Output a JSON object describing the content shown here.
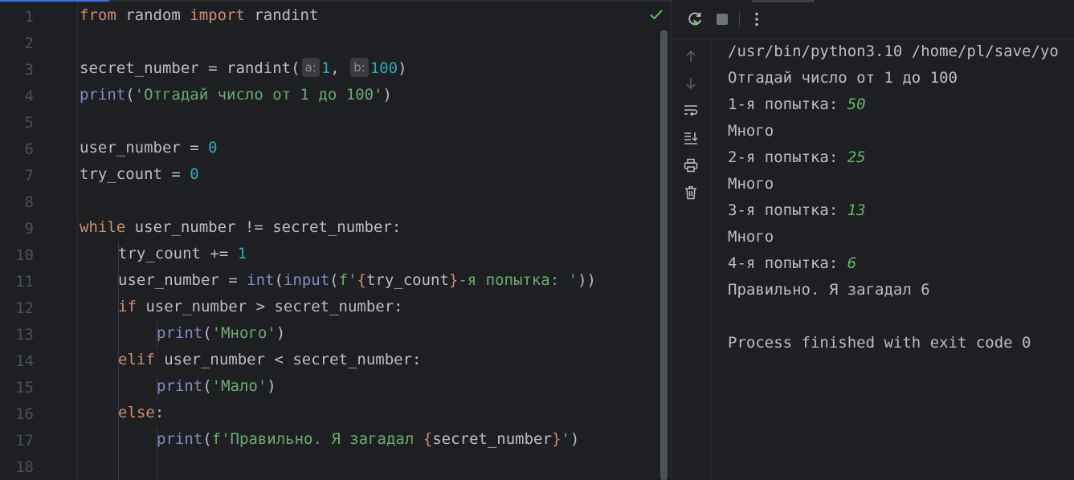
{
  "editor": {
    "line_numbers": [
      "1",
      "2",
      "3",
      "4",
      "5",
      "6",
      "7",
      "8",
      "9",
      "10",
      "11",
      "12",
      "13",
      "14",
      "15",
      "16",
      "17",
      "18"
    ],
    "hints": {
      "a": "a:",
      "b": "b:"
    },
    "tokens": {
      "l1_from": "from",
      "l1_mod": " random ",
      "l1_import": "import",
      "l1_name": " randint",
      "l3_var": "secret_number = ",
      "l3_fn": "randint",
      "l3_open": "(",
      "l3_a": "1",
      "l3_comma": ", ",
      "l3_b": "100",
      "l3_close": ")",
      "l4_print": "print",
      "l4_open": "(",
      "l4_str": "'Отгадай число от 1 до 100'",
      "l4_close": ")",
      "l6_var": "user_number = ",
      "l6_val": "0",
      "l7_var": "try_count = ",
      "l7_val": "0",
      "l9_while": "while",
      "l9_rest": " user_number != secret_number:",
      "l10_var": "try_count += ",
      "l10_val": "1",
      "l11_var": "user_number = ",
      "l11_int": "int",
      "l11_p1": "(",
      "l11_input": "input",
      "l11_p2": "(",
      "l11_fpre": "f'",
      "l11_brace1": "{",
      "l11_expr": "try_count",
      "l11_brace2": "}",
      "l11_str": "-я попытка: '",
      "l11_close": "))",
      "l12_if": "if",
      "l12_rest": " user_number > secret_number:",
      "l13_print": "print",
      "l13_open": "(",
      "l13_str": "'Много'",
      "l13_close": ")",
      "l14_elif": "elif",
      "l14_rest": " user_number < secret_number:",
      "l15_print": "print",
      "l15_open": "(",
      "l15_str": "'Мало'",
      "l15_close": ")",
      "l16_else": "else",
      "l16_colon": ":",
      "l17_print": "print",
      "l17_open": "(",
      "l17_fpre": "f'Правильно. Я загадал ",
      "l17_brace1": "{",
      "l17_expr": "secret_number",
      "l17_brace2": "}",
      "l17_str": "'",
      "l17_close": ")"
    }
  },
  "run": {
    "icons": [
      "rerun-icon",
      "stop-icon",
      "more-options-icon",
      "arrow-up-icon",
      "arrow-down-icon",
      "soft-wrap-icon",
      "scroll-to-end-icon",
      "print-icon",
      "trash-icon"
    ],
    "console": {
      "l1": "/usr/bin/python3.10 /home/pl/save/yo",
      "l2": "Отгадай число от 1 до 100",
      "l3_prompt": "1-я попытка: ",
      "l3_in": "50",
      "l4": "Много",
      "l5_prompt": "2-я попытка: ",
      "l5_in": "25",
      "l6": "Много",
      "l7_prompt": "3-я попытка: ",
      "l7_in": "13",
      "l8": "Много",
      "l9_prompt": "4-я попытка: ",
      "l9_in": "6",
      "l10": "Правильно. Я загадал 6",
      "l12": "Process finished with exit code 0"
    }
  },
  "colors": {
    "background": "#1e1f22",
    "keyword": "#cf8e6d",
    "builtin": "#8888c6",
    "number": "#2aacb8",
    "string": "#6aab73",
    "input_value": "#5fb865",
    "accent": "#3574f0"
  }
}
